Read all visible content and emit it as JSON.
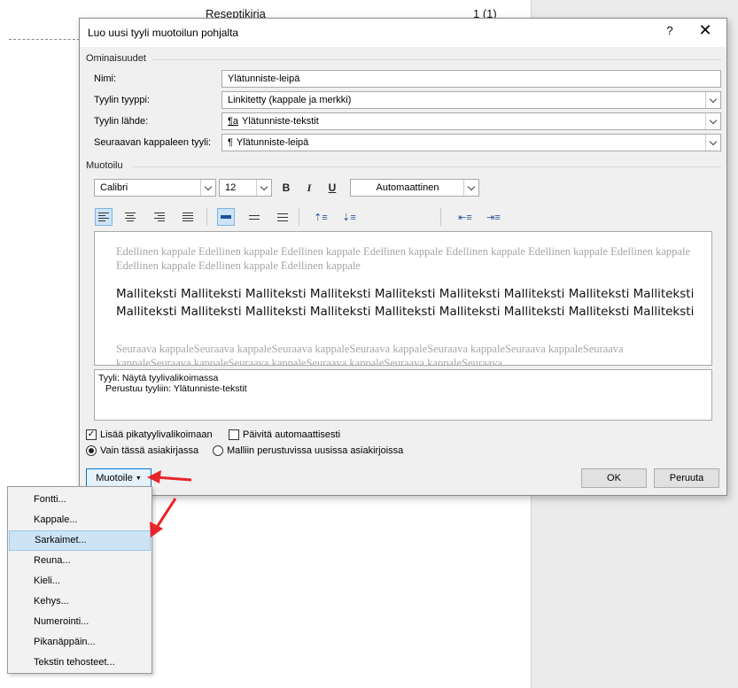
{
  "background": {
    "header_text": "Reseptikirja",
    "page_number": "1 (1)"
  },
  "dialog": {
    "title": "Luo uusi tyyli muotoilun pohjalta",
    "help": "?",
    "close": "✕",
    "properties": {
      "section_title": "Ominaisuudet",
      "name_label": "Nimi:",
      "name_value": "Ylätunniste-leipä",
      "type_label": "Tyylin tyyppi:",
      "type_value": "Linkitetty (kappale ja merkki)",
      "base_label": "Tyylin lähde:",
      "base_icon": "¶a",
      "base_value": "Ylätunniste-tekstit",
      "next_label": "Seuraavan kappaleen tyyli:",
      "next_icon": "¶",
      "next_value": "Ylätunniste-leipä"
    },
    "formatting": {
      "section_title": "Muotoilu",
      "font": "Calibri",
      "size": "12",
      "bold": "B",
      "italic": "I",
      "underline": "U",
      "color": "Automaattinen"
    },
    "preview": {
      "previous_text": "Edellinen kappale Edellinen kappale Edellinen kappale Edellinen kappale Edellinen kappale Edellinen kappale Edellinen kappale Edellinen kappale Edellinen kappale Edellinen kappale",
      "sample_text": "Malliteksti Malliteksti Malliteksti Malliteksti Malliteksti Malliteksti Malliteksti Malliteksti Malliteksti Malliteksti Malliteksti Malliteksti Malliteksti Malliteksti Malliteksti Malliteksti Malliteksti Malliteksti",
      "next_text": "Seuraava kappaleSeuraava kappaleSeuraava kappaleSeuraava kappaleSeuraava kappaleSeuraava kappaleSeuraava kappaleSeuraava kappaleSeuraava kappaleSeuraava kappaleSeuraava kappaleSeuraava"
    },
    "description": {
      "line1": "Tyyli: Näytä tyylivalikoimassa",
      "line2": "Perustuu tyyliin: Ylätunniste-tekstit"
    },
    "options": {
      "add_to_gallery": "Lisää pikatyylivalikoimaan",
      "auto_update": "Päivitä automaattisesti",
      "only_this_doc": "Vain tässä asiakirjassa",
      "new_docs": "Malliin perustuvissa uusissa asiakirjoissa"
    },
    "buttons": {
      "format": "Muotoile",
      "ok": "OK",
      "cancel": "Peruuta"
    }
  },
  "menu": {
    "items": [
      "Fontti...",
      "Kappale...",
      "Sarkaimet...",
      "Reuna...",
      "Kieli...",
      "Kehys...",
      "Numerointi...",
      "Pikanäppäin...",
      "Tekstin tehosteet..."
    ]
  },
  "colors": {
    "arrow": "#e8242a",
    "menu_highlight": "#cde4f7",
    "dialog_bg": "#f0f0f0"
  }
}
